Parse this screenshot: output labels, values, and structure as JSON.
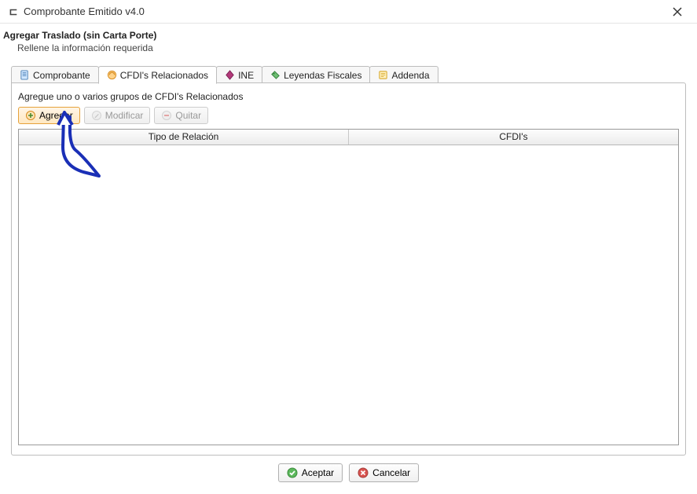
{
  "window": {
    "title": "Comprobante Emitido v4.0"
  },
  "header": {
    "title": "Agregar Traslado (sin Carta Porte)",
    "subtitle": "Rellene la información requerida"
  },
  "tabs": [
    {
      "label": "Comprobante"
    },
    {
      "label": "CFDI's Relacionados"
    },
    {
      "label": "INE"
    },
    {
      "label": "Leyendas Fiscales"
    },
    {
      "label": "Addenda"
    }
  ],
  "panel": {
    "instruction": "Agregue uno o varios grupos de CFDI's Relacionados",
    "toolbar": {
      "add_label": "Agregar",
      "edit_label": "Modificar",
      "remove_label": "Quitar"
    },
    "grid": {
      "columns": [
        {
          "label": "Tipo de Relación"
        },
        {
          "label": "CFDI's"
        }
      ],
      "rows": []
    }
  },
  "footer": {
    "accept_label": "Aceptar",
    "cancel_label": "Cancelar"
  }
}
